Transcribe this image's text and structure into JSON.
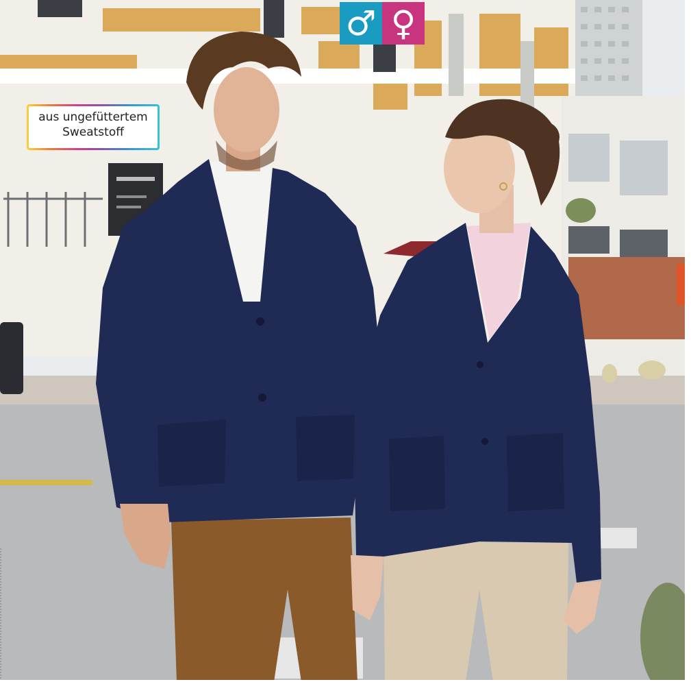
{
  "gender_icons": [
    {
      "icon": "male-symbol-icon",
      "glyph": "♂",
      "color": "#1a9bc2"
    },
    {
      "icon": "female-symbol-icon",
      "glyph": "♀",
      "color": "#c8357e"
    }
  ],
  "badge": {
    "line1": "aus ungefüttertem",
    "line2": "Sweatstoff"
  },
  "colors": {
    "jacket_navy": "#1f2a55",
    "trousers_brown": "#8b5a2b",
    "trousers_beige": "#d9c9b0",
    "shirt_white": "#f4f4f2",
    "shirt_pink": "#f2d2dc"
  }
}
